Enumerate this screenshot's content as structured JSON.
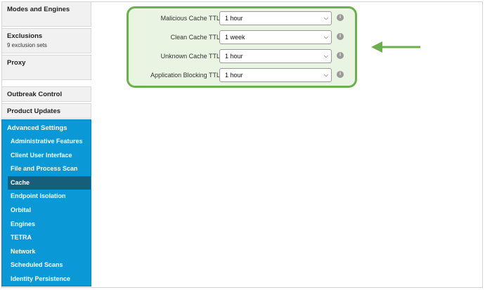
{
  "sidebar": {
    "modes": {
      "title": "Modes and Engines"
    },
    "exclusions": {
      "title": "Exclusions",
      "sub": "9 exclusion sets"
    },
    "proxy": {
      "title": "Proxy"
    },
    "outbreak": {
      "title": "Outbreak Control"
    },
    "updates": {
      "title": "Product Updates"
    },
    "advanced": {
      "title": "Advanced Settings",
      "items": [
        {
          "label": "Administrative Features"
        },
        {
          "label": "Client User Interface"
        },
        {
          "label": "File and Process Scan"
        },
        {
          "label": "Cache"
        },
        {
          "label": "Endpoint Isolation"
        },
        {
          "label": "Orbital"
        },
        {
          "label": "Engines"
        },
        {
          "label": "TETRA"
        },
        {
          "label": "Network"
        },
        {
          "label": "Scheduled Scans"
        },
        {
          "label": "Identity Persistence"
        }
      ],
      "active_index": 3
    }
  },
  "cache": {
    "rows": [
      {
        "label": "Malicious Cache TTL",
        "value": "1 hour"
      },
      {
        "label": "Clean Cache TTL",
        "value": "1 week"
      },
      {
        "label": "Unknown Cache TTL",
        "value": "1 hour"
      },
      {
        "label": "Application Blocking TTL",
        "value": "1 hour"
      }
    ]
  },
  "colors": {
    "sidebar_accent": "#0b98d6",
    "active_item": "#155f7d",
    "highlight_border": "#6ab04c",
    "highlight_fill": "#eaf4e2",
    "arrow": "#6ab04c"
  },
  "icons": {
    "info": "info-icon",
    "dropdown": "chevron-down-icon",
    "pointer": "arrow-left-icon"
  }
}
